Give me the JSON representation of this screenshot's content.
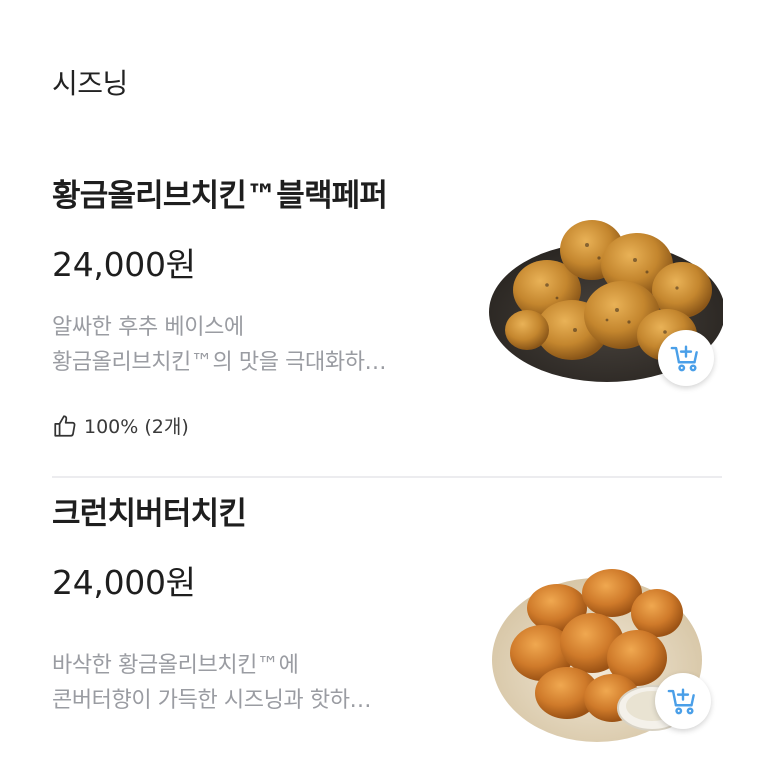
{
  "section": {
    "title": "시즈닝"
  },
  "items": [
    {
      "name": "황금올리브치킨™블랙페퍼",
      "price": "24,000원",
      "desc_line1": "알싸한 후추 베이스에",
      "desc_line2": "황금올리브치킨™의 맛을 극대화하…",
      "rating": "100% (2개)",
      "rating_icon": "thumbs-up-icon",
      "cart_icon": "add-to-cart-icon"
    },
    {
      "name": "크런치버터치킨",
      "price": "24,000원",
      "desc_line1": "바삭한 황금올리브치킨™에",
      "desc_line2": "콘버터향이 가득한 시즈닝과 핫하…",
      "cart_icon": "add-to-cart-icon"
    }
  ],
  "colors": {
    "text_primary": "#1e1e1e",
    "text_secondary": "#9a9ca2",
    "divider": "#ececef",
    "cart_icon": "#4a9fe8"
  }
}
